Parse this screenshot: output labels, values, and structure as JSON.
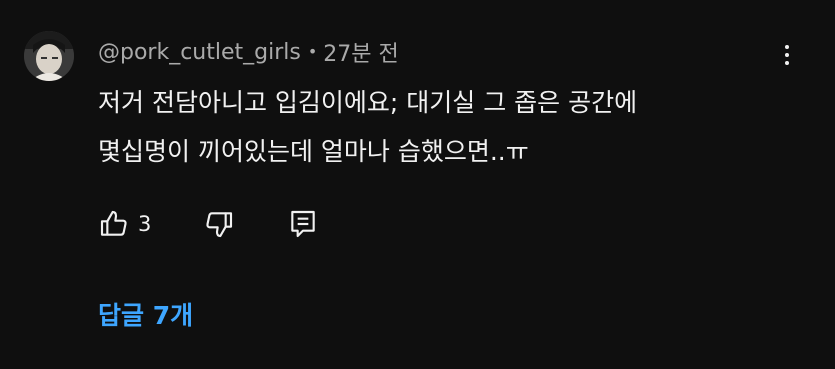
{
  "comment": {
    "author": "@pork_cutlet_girls",
    "separator": "•",
    "timestamp": "27분 전",
    "lines": [
      "저거 전담아니고 입김이에요; 대기실 그 좁은 공간에",
      "몇십명이 끼어있는데 얼마나 습했으면..ㅠ"
    ],
    "like_count": "3",
    "replies_label": "답글 7개"
  },
  "icons": {
    "like": "thumbs-up-icon",
    "dislike": "thumbs-down-icon",
    "reply": "comment-reply-icon",
    "menu": "more-vertical-icon"
  },
  "colors": {
    "background": "#0f0f0f",
    "text": "#f1f1f1",
    "meta": "#aaaaaa",
    "accent": "#3ea6ff"
  }
}
